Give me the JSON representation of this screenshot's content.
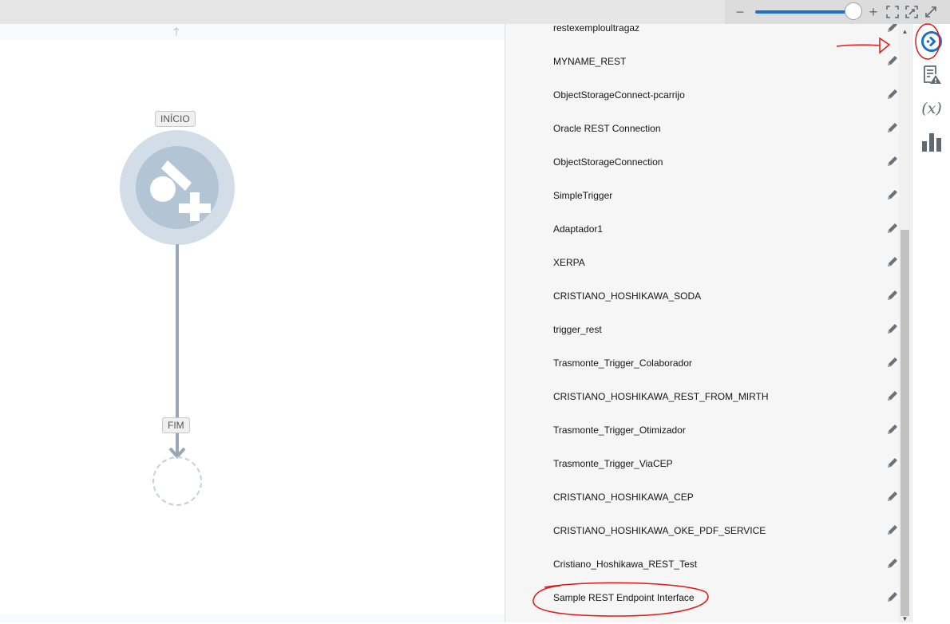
{
  "toolbar": {
    "zoom_out_symbol": "−",
    "zoom_in_symbol": "+",
    "zoom_level": 0.99,
    "icons": [
      "minus-icon",
      "plus-icon",
      "fit-icon",
      "reset-zoom-icon",
      "expand-icon"
    ]
  },
  "canvas": {
    "start_label": "INÍCIO",
    "end_label": "FIM"
  },
  "connections": {
    "items": [
      "restexemploultragaz",
      "MYNAME_REST",
      "ObjectStorageConnect-pcarrijo",
      "Oracle REST Connection",
      "ObjectStorageConnection",
      "SimpleTrigger",
      "Adaptador1",
      "XERPA",
      "CRISTIANO_HOSHIKAWA_SODA",
      "trigger_rest",
      "Trasmonte_Trigger_Colaborador",
      "CRISTIANO_HOSHIKAWA_REST_FROM_MIRTH",
      "Trasmonte_Trigger_Otimizador",
      "Trasmonte_Trigger_ViaCEP",
      "CRISTIANO_HOSHIKAWA_CEP",
      "CRISTIANO_HOSHIKAWA_OKE_PDF_SERVICE",
      "Cristiano_Hoshikawa_REST_Test",
      "Sample REST Endpoint Interface"
    ]
  },
  "rail": {
    "icons": [
      "triggers-icon",
      "errors-warnings-icon",
      "variables-icon",
      "analytics-icon"
    ]
  },
  "colors": {
    "accent": "#1a73c8",
    "annotation": "#e01818",
    "node_fill": "#d2dde8",
    "panel_bg": "#f6f6f6"
  }
}
